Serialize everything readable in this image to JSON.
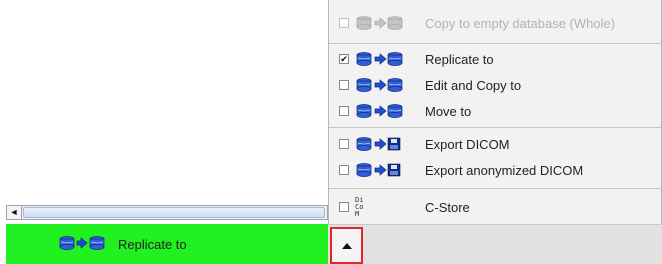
{
  "menu": {
    "items": [
      {
        "label": "Copy to empty database (Whole)",
        "checked": false,
        "enabled": false,
        "icon": "database-to-database-icon"
      },
      {
        "label": "Replicate to",
        "checked": true,
        "enabled": true,
        "icon": "database-to-database-icon"
      },
      {
        "label": "Edit and Copy to",
        "checked": false,
        "enabled": true,
        "icon": "database-to-database-icon"
      },
      {
        "label": "Move to",
        "checked": false,
        "enabled": true,
        "icon": "database-to-database-icon"
      },
      {
        "label": "Export DICOM",
        "checked": false,
        "enabled": true,
        "icon": "database-to-disk-icon"
      },
      {
        "label": "Export anonymized DICOM",
        "checked": false,
        "enabled": true,
        "icon": "database-to-disk-icon"
      },
      {
        "label": "C-Store",
        "checked": false,
        "enabled": true,
        "icon": "dicom-icon"
      }
    ]
  },
  "status_bar": {
    "label": "Replicate to",
    "color": "#21f021"
  },
  "toolbar": {
    "toggle_icon": "triangle-up-icon"
  },
  "icon_glyphs": {
    "checkmark": "✔",
    "left_arrow": "◄",
    "dicom": "Di Co M"
  },
  "colors": {
    "accent_red": "#e2262b",
    "db_blue": "#2352c8",
    "arrow_blue": "#1d4fd3"
  }
}
